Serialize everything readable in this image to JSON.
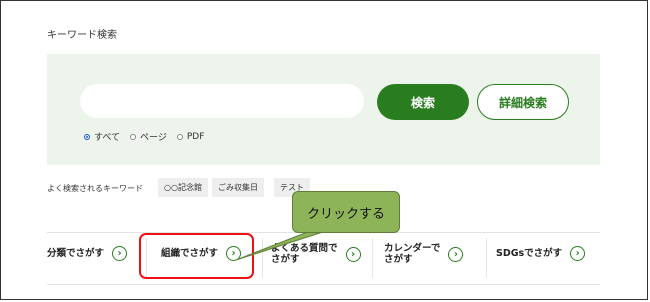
{
  "search": {
    "title": "キーワード検索",
    "input_value": "",
    "search_button": "検索",
    "detail_button": "詳細検索",
    "scope_options": [
      "すべて",
      "ページ",
      "PDF"
    ],
    "selected_scope": "すべて"
  },
  "popular": {
    "label": "よく検索されるキーワード",
    "tags": [
      "○○記念館",
      "ごみ収集日",
      "テスト"
    ]
  },
  "callout": {
    "text": "クリックする"
  },
  "categories": [
    {
      "label": "分類でさがす",
      "icon": "chevron-right-circle"
    },
    {
      "label": "組織でさがす",
      "icon": "chevron-right-circle"
    },
    {
      "label_line1": "よくある質問で",
      "label_line2": "さがす",
      "icon": "chevron-right-circle"
    },
    {
      "label_line1": "カレンダーで",
      "label_line2": "さがす",
      "icon": "chevron-right-circle"
    },
    {
      "label": "SDGsでさがす",
      "icon": "chevron-right-circle"
    }
  ],
  "colors": {
    "accent": "#2a7d1f",
    "panel": "#ecf4eb",
    "highlight": "#ee1111",
    "callout": "#8eb459"
  }
}
